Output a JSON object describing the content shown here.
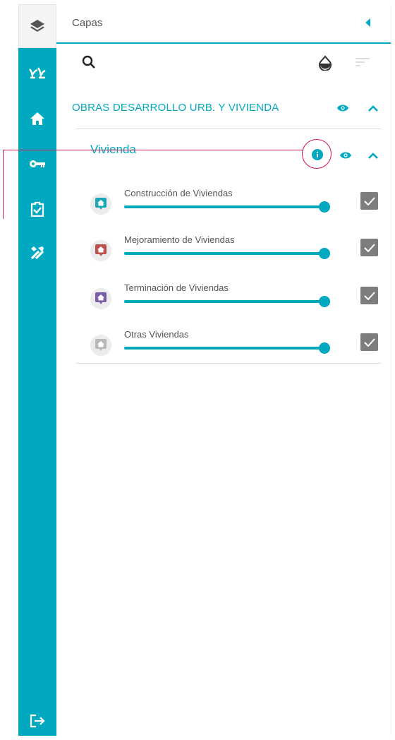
{
  "panel": {
    "title": "Capas"
  },
  "rail": {
    "items": [
      {
        "icon": "nature-icon"
      },
      {
        "icon": "home-icon"
      },
      {
        "icon": "key-icon"
      },
      {
        "icon": "clipboard-check-icon"
      },
      {
        "icon": "tools-icon"
      }
    ],
    "logout_icon": "logout-icon"
  },
  "group": {
    "title": "OBRAS DESARROLLO URB. Y VIVIENDA"
  },
  "subgroup": {
    "title": "Vivienda"
  },
  "layers": [
    {
      "label": "Construcción de Viviendas",
      "color": "#1aa6b7",
      "opacity": 1,
      "checked": true
    },
    {
      "label": "Mejoramiento de Viviendas",
      "color": "#c0504d",
      "opacity": 1,
      "checked": true
    },
    {
      "label": "Terminación de Viviendas",
      "color": "#7b5ca8",
      "opacity": 1,
      "checked": true
    },
    {
      "label": "Otras Viviendas",
      "color": "#b8b8b8",
      "opacity": 1,
      "checked": true
    }
  ],
  "colors": {
    "accent": "#00a9bf",
    "callout": "#d4145a"
  }
}
